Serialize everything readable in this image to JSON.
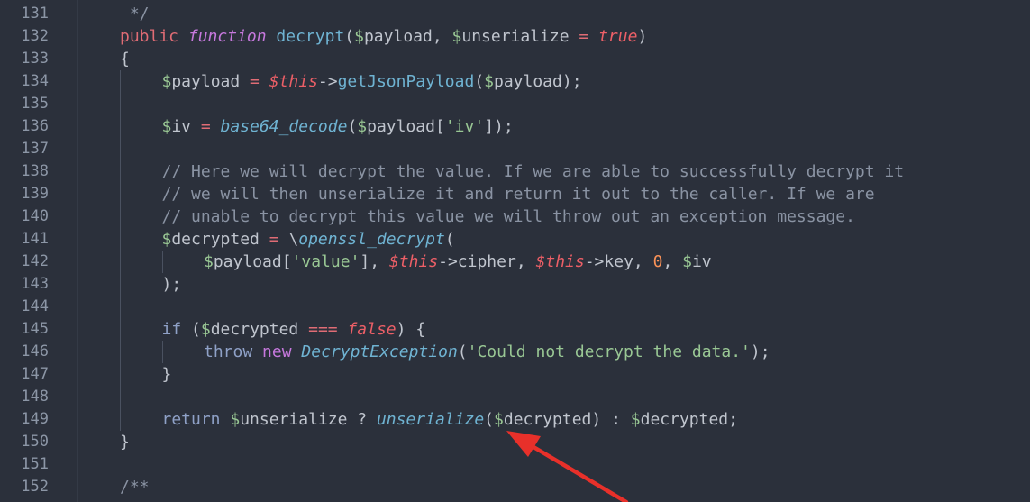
{
  "colors": {
    "background": "#2b303b",
    "line_number": "#8c96a6",
    "annotation_arrow": "#e8302a"
  },
  "gutter": {
    "line_numbers": [
      "131",
      "132",
      "133",
      "134",
      "135",
      "136",
      "137",
      "138",
      "139",
      "140",
      "141",
      "142",
      "143",
      "144",
      "145",
      "146",
      "147",
      "148",
      "149",
      "150",
      "151",
      "152"
    ]
  },
  "code_lines": [
    {
      "indent": 0,
      "tokens": [
        {
          "t": " */",
          "c": "t-com"
        }
      ]
    },
    {
      "indent": 0,
      "tokens": [
        {
          "t": "public",
          "c": "t-pub"
        },
        {
          "t": " ",
          "c": "t-punc"
        },
        {
          "t": "function",
          "c": "t-fn-kw"
        },
        {
          "t": " ",
          "c": "t-punc"
        },
        {
          "t": "decrypt",
          "c": "t-fn"
        },
        {
          "t": "(",
          "c": "t-punc"
        },
        {
          "t": "$",
          "c": "t-dollar"
        },
        {
          "t": "payload",
          "c": "t-var"
        },
        {
          "t": ", ",
          "c": "t-punc"
        },
        {
          "t": "$",
          "c": "t-dollar"
        },
        {
          "t": "unserialize",
          "c": "t-var"
        },
        {
          "t": " = ",
          "c": "t-op"
        },
        {
          "t": "true",
          "c": "t-bool"
        },
        {
          "t": ")",
          "c": "t-punc"
        }
      ]
    },
    {
      "indent": 0,
      "tokens": [
        {
          "t": "{",
          "c": "t-punc"
        }
      ]
    },
    {
      "indent": 1,
      "tokens": [
        {
          "t": "$",
          "c": "t-dollar"
        },
        {
          "t": "payload",
          "c": "t-var"
        },
        {
          "t": " = ",
          "c": "t-op"
        },
        {
          "t": "$this",
          "c": "t-this"
        },
        {
          "t": "->",
          "c": "t-punc"
        },
        {
          "t": "getJsonPayload",
          "c": "t-fn"
        },
        {
          "t": "(",
          "c": "t-punc"
        },
        {
          "t": "$",
          "c": "t-dollar"
        },
        {
          "t": "payload",
          "c": "t-var"
        },
        {
          "t": ");",
          "c": "t-punc"
        }
      ]
    },
    {
      "indent": 1,
      "tokens": []
    },
    {
      "indent": 1,
      "tokens": [
        {
          "t": "$",
          "c": "t-dollar"
        },
        {
          "t": "iv",
          "c": "t-var"
        },
        {
          "t": " = ",
          "c": "t-op"
        },
        {
          "t": "base64_decode",
          "c": "t-fn-it"
        },
        {
          "t": "(",
          "c": "t-punc"
        },
        {
          "t": "$",
          "c": "t-dollar"
        },
        {
          "t": "payload",
          "c": "t-var"
        },
        {
          "t": "[",
          "c": "t-punc"
        },
        {
          "t": "'iv'",
          "c": "t-str"
        },
        {
          "t": "]);",
          "c": "t-punc"
        }
      ]
    },
    {
      "indent": 1,
      "tokens": []
    },
    {
      "indent": 1,
      "tokens": [
        {
          "t": "// Here we will decrypt the value. If we are able to successfully decrypt it",
          "c": "t-com"
        }
      ]
    },
    {
      "indent": 1,
      "tokens": [
        {
          "t": "// we will then unserialize it and return it out to the caller. If we are",
          "c": "t-com"
        }
      ]
    },
    {
      "indent": 1,
      "tokens": [
        {
          "t": "// unable to decrypt this value we will throw out an exception message.",
          "c": "t-com"
        }
      ]
    },
    {
      "indent": 1,
      "tokens": [
        {
          "t": "$",
          "c": "t-dollar"
        },
        {
          "t": "decrypted",
          "c": "t-var"
        },
        {
          "t": " = ",
          "c": "t-op"
        },
        {
          "t": "\\",
          "c": "t-punc"
        },
        {
          "t": "openssl_decrypt",
          "c": "t-fn-it"
        },
        {
          "t": "(",
          "c": "t-punc"
        }
      ]
    },
    {
      "indent": 2,
      "tokens": [
        {
          "t": "$",
          "c": "t-dollar"
        },
        {
          "t": "payload",
          "c": "t-var"
        },
        {
          "t": "[",
          "c": "t-punc"
        },
        {
          "t": "'value'",
          "c": "t-str"
        },
        {
          "t": "], ",
          "c": "t-punc"
        },
        {
          "t": "$this",
          "c": "t-this"
        },
        {
          "t": "->",
          "c": "t-punc"
        },
        {
          "t": "cipher",
          "c": "t-var"
        },
        {
          "t": ", ",
          "c": "t-punc"
        },
        {
          "t": "$this",
          "c": "t-this"
        },
        {
          "t": "->",
          "c": "t-punc"
        },
        {
          "t": "key",
          "c": "t-var"
        },
        {
          "t": ", ",
          "c": "t-punc"
        },
        {
          "t": "0",
          "c": "t-num"
        },
        {
          "t": ", ",
          "c": "t-punc"
        },
        {
          "t": "$",
          "c": "t-dollar"
        },
        {
          "t": "iv",
          "c": "t-var"
        }
      ]
    },
    {
      "indent": 1,
      "tokens": [
        {
          "t": ");",
          "c": "t-punc"
        }
      ]
    },
    {
      "indent": 1,
      "tokens": []
    },
    {
      "indent": 1,
      "tokens": [
        {
          "t": "if",
          "c": "t-ctl"
        },
        {
          "t": " (",
          "c": "t-punc"
        },
        {
          "t": "$",
          "c": "t-dollar"
        },
        {
          "t": "decrypted",
          "c": "t-var"
        },
        {
          "t": " === ",
          "c": "t-op"
        },
        {
          "t": "false",
          "c": "t-bool"
        },
        {
          "t": ") {",
          "c": "t-punc"
        }
      ]
    },
    {
      "indent": 2,
      "tokens": [
        {
          "t": "throw",
          "c": "t-ctl"
        },
        {
          "t": " ",
          "c": "t-punc"
        },
        {
          "t": "new",
          "c": "t-kw"
        },
        {
          "t": " ",
          "c": "t-punc"
        },
        {
          "t": "DecryptException",
          "c": "t-cls"
        },
        {
          "t": "(",
          "c": "t-punc"
        },
        {
          "t": "'Could not decrypt the data.'",
          "c": "t-str"
        },
        {
          "t": ");",
          "c": "t-punc"
        }
      ]
    },
    {
      "indent": 1,
      "tokens": [
        {
          "t": "}",
          "c": "t-punc"
        }
      ]
    },
    {
      "indent": 1,
      "tokens": []
    },
    {
      "indent": 1,
      "tokens": [
        {
          "t": "return",
          "c": "t-ctl"
        },
        {
          "t": " ",
          "c": "t-punc"
        },
        {
          "t": "$",
          "c": "t-dollar"
        },
        {
          "t": "unserialize",
          "c": "t-var"
        },
        {
          "t": " ? ",
          "c": "t-punc"
        },
        {
          "t": "unserialize",
          "c": "t-fn-it"
        },
        {
          "t": "(",
          "c": "t-punc"
        },
        {
          "t": "$",
          "c": "t-dollar"
        },
        {
          "t": "decrypted",
          "c": "t-var"
        },
        {
          "t": ") : ",
          "c": "t-punc"
        },
        {
          "t": "$",
          "c": "t-dollar"
        },
        {
          "t": "decrypted",
          "c": "t-var"
        },
        {
          "t": ";",
          "c": "t-punc"
        }
      ]
    },
    {
      "indent": 0,
      "tokens": [
        {
          "t": "}",
          "c": "t-punc"
        }
      ]
    },
    {
      "indent": 0,
      "tokens": []
    },
    {
      "indent": 0,
      "tokens": [
        {
          "t": "/**",
          "c": "t-com"
        }
      ]
    }
  ]
}
